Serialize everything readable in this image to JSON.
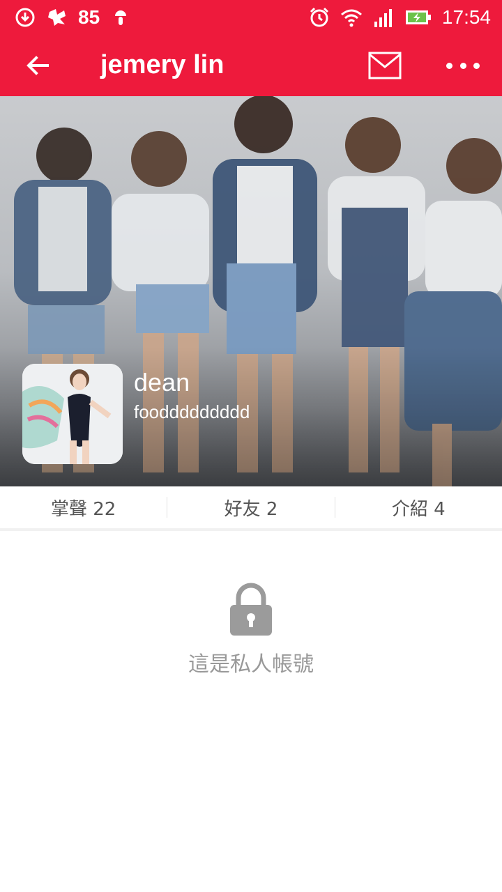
{
  "status_bar": {
    "notification_count": "85",
    "time": "17:54",
    "icons": [
      "download-icon",
      "app-icon",
      "android-icon",
      "alarm-icon",
      "wifi-icon",
      "signal-icon",
      "battery-charging-icon"
    ]
  },
  "toolbar": {
    "title": "jemery lin",
    "icons": [
      "back-arrow-icon",
      "mail-icon",
      "more-icon"
    ]
  },
  "profile": {
    "name": "dean",
    "bio": "fooddddddddd"
  },
  "stats": [
    {
      "label": "掌聲 22"
    },
    {
      "label": "好友 2"
    },
    {
      "label": "介紹 4"
    }
  ],
  "private": {
    "message": "這是私人帳號",
    "icon": "lock-icon"
  },
  "colors": {
    "brand": "#ee1a3c",
    "muted_text": "#999999",
    "stat_text": "#555555"
  }
}
